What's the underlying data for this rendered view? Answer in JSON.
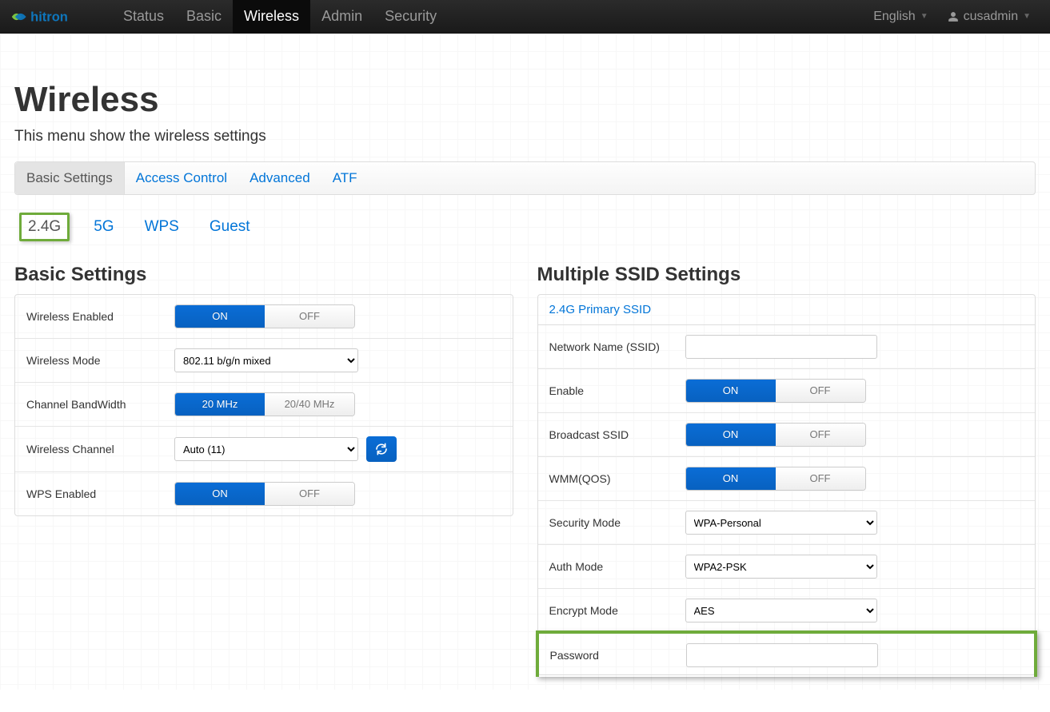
{
  "brand": "hitron",
  "nav": {
    "items": [
      "Status",
      "Basic",
      "Wireless",
      "Admin",
      "Security"
    ],
    "active": 2,
    "language": "English",
    "user": "cusadmin"
  },
  "page": {
    "title": "Wireless",
    "subtitle": "This menu show the wireless settings"
  },
  "tabs_primary": {
    "items": [
      "Basic Settings",
      "Access Control",
      "Advanced",
      "ATF"
    ],
    "active": 0
  },
  "tabs_secondary": {
    "items": [
      "2.4G",
      "5G",
      "WPS",
      "Guest"
    ],
    "active": 0
  },
  "basic_settings": {
    "title": "Basic Settings",
    "rows": {
      "wireless_enabled": {
        "label": "Wireless Enabled",
        "on": "ON",
        "off": "OFF"
      },
      "wireless_mode": {
        "label": "Wireless Mode",
        "value": "802.11 b/g/n mixed"
      },
      "channel_bw": {
        "label": "Channel BandWidth",
        "opt1": "20 MHz",
        "opt2": "20/40 MHz"
      },
      "wireless_channel": {
        "label": "Wireless Channel",
        "value": "Auto (11)"
      },
      "wps_enabled": {
        "label": "WPS Enabled",
        "on": "ON",
        "off": "OFF"
      }
    }
  },
  "ssid_settings": {
    "title": "Multiple SSID Settings",
    "link": "2.4G Primary SSID",
    "rows": {
      "ssid": {
        "label": "Network Name (SSID)",
        "value": ""
      },
      "enable": {
        "label": "Enable",
        "on": "ON",
        "off": "OFF"
      },
      "broadcast": {
        "label": "Broadcast SSID",
        "on": "ON",
        "off": "OFF"
      },
      "wmm": {
        "label": "WMM(QOS)",
        "on": "ON",
        "off": "OFF"
      },
      "security_mode": {
        "label": "Security Mode",
        "value": "WPA-Personal"
      },
      "auth_mode": {
        "label": "Auth Mode",
        "value": "WPA2-PSK"
      },
      "encrypt_mode": {
        "label": "Encrypt Mode",
        "value": "AES"
      },
      "password": {
        "label": "Password",
        "value": ""
      }
    }
  }
}
